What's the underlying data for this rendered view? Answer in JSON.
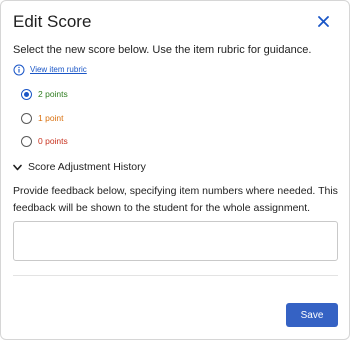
{
  "dialog": {
    "title": "Edit Score",
    "close_icon": "close-icon",
    "instruction": "Select the new score below. Use the item rubric for guidance.",
    "rubric_link": "View item rubric",
    "rubric_icon": "info-icon"
  },
  "score_options": [
    {
      "label": "2 points",
      "color": "#2e7d1f",
      "selected": true
    },
    {
      "label": "1 point",
      "color": "#d9700e",
      "selected": false
    },
    {
      "label": "0 points",
      "color": "#c8321f",
      "selected": false
    }
  ],
  "history": {
    "label": "Score Adjustment History",
    "icon": "chevron-down-icon"
  },
  "feedback": {
    "instruction": "Provide feedback below, specifying item numbers where needed. This feedback will be shown to the student for the whole assignment.",
    "value": "",
    "placeholder": ""
  },
  "footer": {
    "save_label": "Save"
  },
  "colors": {
    "accent": "#1a56c7",
    "save_button": "#3562c4"
  }
}
